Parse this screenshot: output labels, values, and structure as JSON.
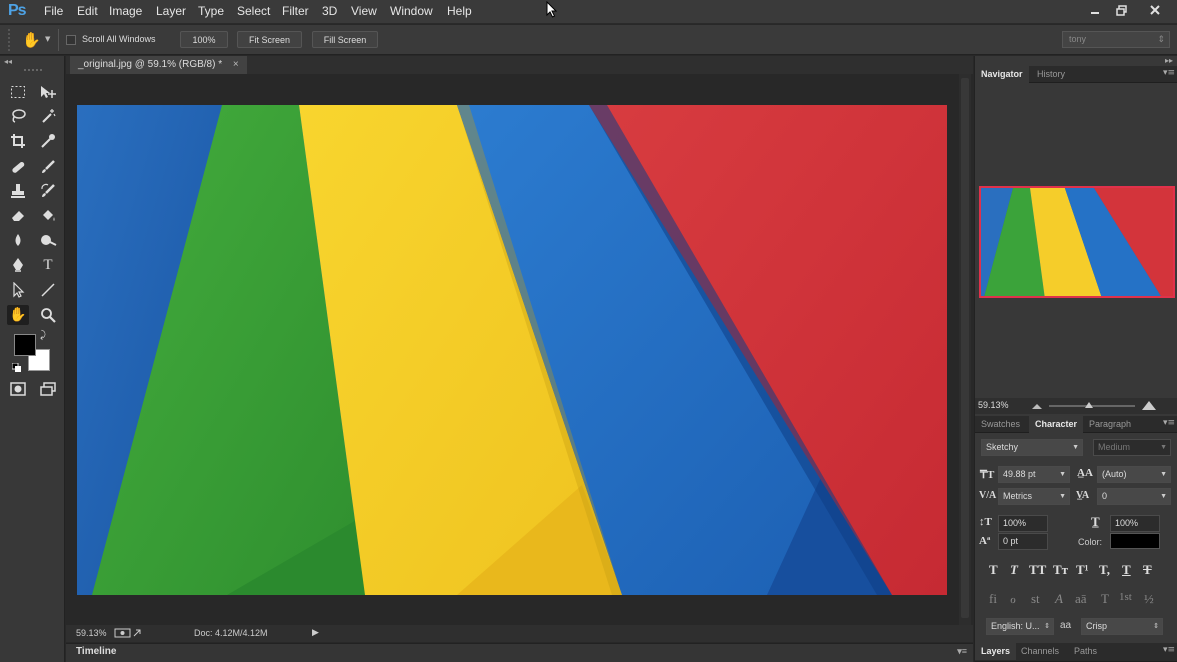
{
  "app": {
    "logo": "Ps"
  },
  "menu": [
    "File",
    "Edit",
    "Image",
    "Layer",
    "Type",
    "Select",
    "Filter",
    "3D",
    "View",
    "Window",
    "Help"
  ],
  "options": {
    "scroll_all_windows": "Scroll All Windows",
    "zoom_btn": "100%",
    "fit_screen": "Fit Screen",
    "fill_screen": "Fill Screen",
    "workspace": "tony"
  },
  "document": {
    "tab_title": "_original.jpg @ 59.1% (RGB/8) *",
    "close": "×",
    "zoom": "59.13%",
    "doc_info": "Doc: 4.12M/4.12M"
  },
  "timeline": {
    "label": "Timeline"
  },
  "navigator": {
    "tabs": [
      "Navigator",
      "History"
    ],
    "zoom": "59.13%"
  },
  "character": {
    "tabs": [
      "Swatches",
      "Character",
      "Paragraph"
    ],
    "font_family": "Sketchy",
    "font_style": "Medium",
    "font_size": "49.88 pt",
    "leading": "(Auto)",
    "kerning": "Metrics",
    "tracking": "0",
    "vertical_scale": "100%",
    "horizontal_scale": "100%",
    "baseline_shift": "0 pt",
    "color_label": "Color:",
    "language": "English: U...",
    "antialias_icon": "aa",
    "antialias": "Crisp",
    "style_glyphs": [
      "T",
      "T",
      "TT",
      "Tт",
      "T¹",
      "T,",
      "T",
      "T"
    ],
    "opentype_glyphs": [
      "fi",
      "ℴ",
      "st",
      "A",
      "aā",
      "T",
      "1st",
      "½"
    ]
  },
  "layers": {
    "tabs": [
      "Layers",
      "Channels",
      "Paths"
    ]
  },
  "colors": {
    "canvas_blue": "#1f67b8",
    "canvas_green": "#3ba33a",
    "canvas_yellow": "#f5cd2a",
    "canvas_red": "#d3343b",
    "nav_highlight": "#e0314b"
  }
}
